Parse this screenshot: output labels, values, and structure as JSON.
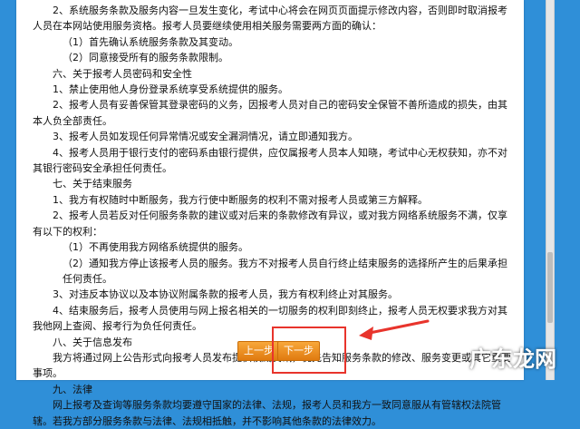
{
  "content": {
    "lines": [
      {
        "text": "2、系统服务条款及服务内容一旦发生变化，考试中心将会在网页页面提示修改内容，否则即时取消报考人员在本网站使用服务资格。报考人员要继续使用相关服务需要两方面的确认：",
        "style": "indent"
      },
      {
        "text": "（1）首先确认系统服务条款及其变动。",
        "style": "indent-sub"
      },
      {
        "text": "（2）同意接受所有的服务条款限制。",
        "style": "indent-sub"
      },
      {
        "text": "六、关于报考人员密码和安全性",
        "style": "indent"
      },
      {
        "text": "1、禁止使用他人身份登录系统享受系统提供的服务。",
        "style": "indent"
      },
      {
        "text": "2、报考人员有妥善保管其登录密码的义务，因报考人员对自己的密码安全保管不善所造成的损失，由其本人负全部责任。",
        "style": "indent"
      },
      {
        "text": "3、报考人员如发现任何异常情况或安全漏洞情况，请立即通知我方。",
        "style": "indent"
      },
      {
        "text": "4、报考人员用于银行支付的密码系由银行提供，应仅属报考人员本人知晓，考试中心无权获知，亦不对其银行密码安全承担任何责任。",
        "style": "indent"
      },
      {
        "text": "七、关于结束服务",
        "style": "indent"
      },
      {
        "text": "1、我方有权随时中断服务，我方行使中断服务的权利不需对报考人员或第三方解释。",
        "style": "indent"
      },
      {
        "text": "2、报考人员若反对任何服务条款的建议或对后来的条款修改有异议，或对我方网络系统服务不满，仅享有以下的权利：",
        "style": "indent"
      },
      {
        "text": "（1）不再使用我方网络系统提供的服务。",
        "style": "indent-sub"
      },
      {
        "text": "（2）通知我方停止该报考人员的服务。我方不对报考人员自行终止结束服务的选择所产生的后果承担任何责任。",
        "style": "indent-sub"
      },
      {
        "text": "3、对违反本协议以及本协议附属条款的报考人员，我方有权利终止对其服务。",
        "style": "indent"
      },
      {
        "text": "4、结束服务后，报考人员使用与网上报名相关的一切服务的权利即刻终止，报考人员无权要求我方对其我他网上查阅、报考行为负任何责任。",
        "style": "indent"
      },
      {
        "text": "八、关于信息发布",
        "style": "indent"
      },
      {
        "text": "我方将通过网上公告形式向报考人员发布提供权威资讯，优先告知服务条款的修改、服务变更或其它重要事项。",
        "style": "indent"
      },
      {
        "text": "九、法律",
        "style": "indent"
      },
      {
        "text": "网上报考及查询等服务条款均要遵守国家的法律、法规，报考人员和我方一致同意服从有管辖权法院管辖。若我方部分服务条款与法律、法规相抵触，并不影响其他条款的法律效力。",
        "style": "indent"
      }
    ]
  },
  "buttons": {
    "prev_label": "上一步",
    "next_label": "下一步"
  },
  "watermark": {
    "text": "广东龙网"
  },
  "colors": {
    "background": "#2f8fd8",
    "button": "#f08f22",
    "highlight": "#e8342c"
  }
}
